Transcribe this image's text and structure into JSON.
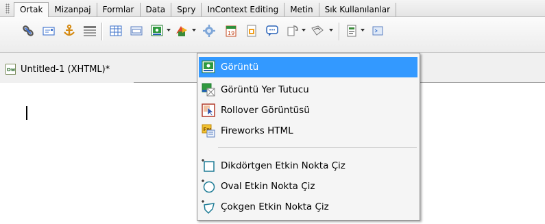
{
  "insert_bar": {
    "tabs": [
      "Ortak",
      "Mizanpaj",
      "Formlar",
      "Data",
      "Spry",
      "InContext Editing",
      "Metin",
      "Sık Kullanılanlar"
    ],
    "active_tab": "Ortak"
  },
  "toolbar": {
    "icons": [
      "hyperlink-icon",
      "email-link-icon",
      "named-anchor-icon",
      "horizontal-rule-icon",
      "table-icon",
      "insert-div-icon",
      "images-icon",
      "media-icon",
      "widget-icon",
      "date-icon",
      "server-side-include-icon",
      "comment-icon",
      "head-icon",
      "script-icon",
      "templates-icon",
      "tag-chooser-icon"
    ]
  },
  "document": {
    "tab_title": "Untitled-1 (XHTML)*"
  },
  "images_menu": {
    "items": [
      {
        "label": "Görüntü",
        "icon": "image-icon",
        "highlighted": true
      },
      {
        "label": "Görüntü Yer Tutucu",
        "icon": "image-placeholder-icon"
      },
      {
        "label": "Rollover Görüntüsü",
        "icon": "rollover-image-icon"
      },
      {
        "label": "Fireworks HTML",
        "icon": "fireworks-html-icon"
      },
      {
        "label": "Dikdörtgen Etkin Nokta Çiz",
        "icon": "rectangle-hotspot-icon"
      },
      {
        "label": "Oval Etkin Nokta Çiz",
        "icon": "oval-hotspot-icon"
      },
      {
        "label": "Çokgen Etkin Nokta Çiz",
        "icon": "polygon-hotspot-icon"
      }
    ]
  },
  "colors": {
    "menu_highlight": "#3399ff",
    "menu_background": "#f5f5f5",
    "editor_background": "#ffffff"
  }
}
